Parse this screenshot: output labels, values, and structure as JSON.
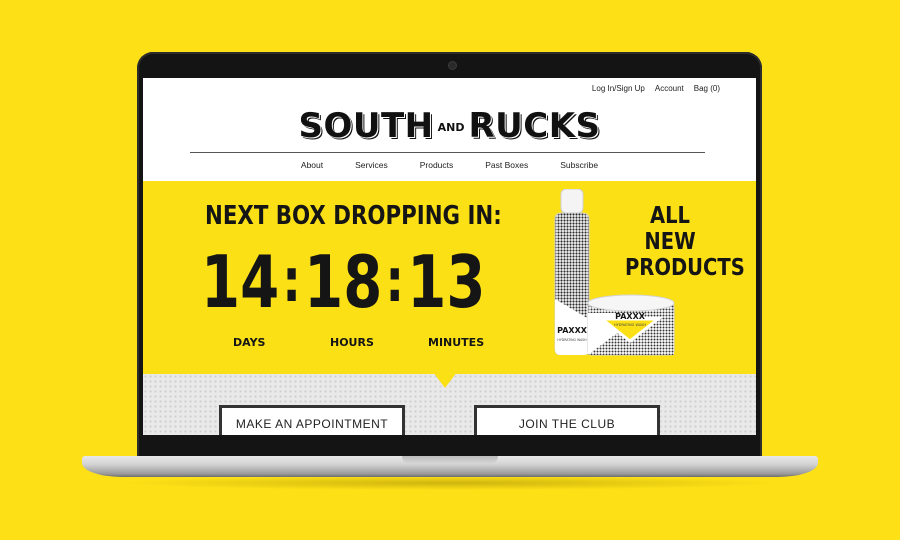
{
  "header": {
    "top_links": [
      "Log In/Sign Up",
      "Account",
      "Bag (0)"
    ],
    "logo_left": "SOUTH",
    "logo_and": "AND",
    "logo_right": "RUCKS",
    "nav": [
      "About",
      "Services",
      "Products",
      "Past Boxes",
      "Subscribe"
    ]
  },
  "hero": {
    "countdown_title": "NEXT BOX DROPPING IN:",
    "days": "14",
    "hours": "18",
    "minutes": "13",
    "days_label": "DAYS",
    "hours_label": "HOURS",
    "minutes_label": "MINUTES",
    "promo_line1": "ALL NEW",
    "promo_line2": "PRODUCTS",
    "bottle_brand": "PAXXX",
    "jar_brand": "PAXXX",
    "product_name": "HYDRATING WASH"
  },
  "actions": {
    "appointment": "MAKE AN APPOINTMENT",
    "join": "JOIN THE CLUB"
  },
  "colors": {
    "brand_yellow": "#fce016",
    "background_yellow": "#fde016",
    "ink": "#151515"
  }
}
